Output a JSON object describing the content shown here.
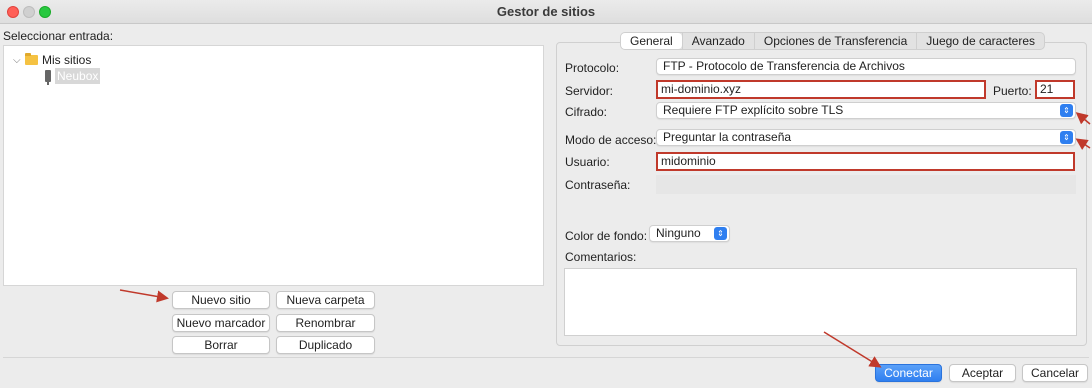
{
  "window": {
    "title": "Gestor de sitios"
  },
  "left": {
    "select_label": "Seleccionar entrada:",
    "tree": {
      "root_label": "Mis sitios",
      "child_label": "Neubox"
    },
    "buttons": {
      "new_site": "Nuevo sitio",
      "new_folder": "Nueva carpeta",
      "new_bookmark": "Nuevo marcador",
      "rename": "Renombrar",
      "delete": "Borrar",
      "duplicate": "Duplicado"
    }
  },
  "tabs": [
    "General",
    "Avanzado",
    "Opciones de Transferencia",
    "Juego de caracteres"
  ],
  "general": {
    "protocol_label": "Protocolo:",
    "protocol_value": "FTP - Protocolo de Transferencia de Archivos",
    "server_label": "Servidor:",
    "server_value": "mi-dominio.xyz",
    "port_label": "Puerto:",
    "port_value": "21",
    "encryption_label": "Cifrado:",
    "encryption_value": "Requiere FTP explícito sobre TLS",
    "access_mode_label": "Modo de acceso:",
    "access_mode_value": "Preguntar la contraseña",
    "user_label": "Usuario:",
    "user_value": "midominio",
    "password_label": "Contraseña:",
    "password_value": "",
    "bg_color_label": "Color de fondo:",
    "bg_color_value": "Ninguno",
    "comments_label": "Comentarios:"
  },
  "footer": {
    "connect": "Conectar",
    "accept": "Aceptar",
    "cancel": "Cancelar"
  },
  "colors": {
    "accent": "#2f7ff0",
    "highlight_border": "#c0392b"
  }
}
